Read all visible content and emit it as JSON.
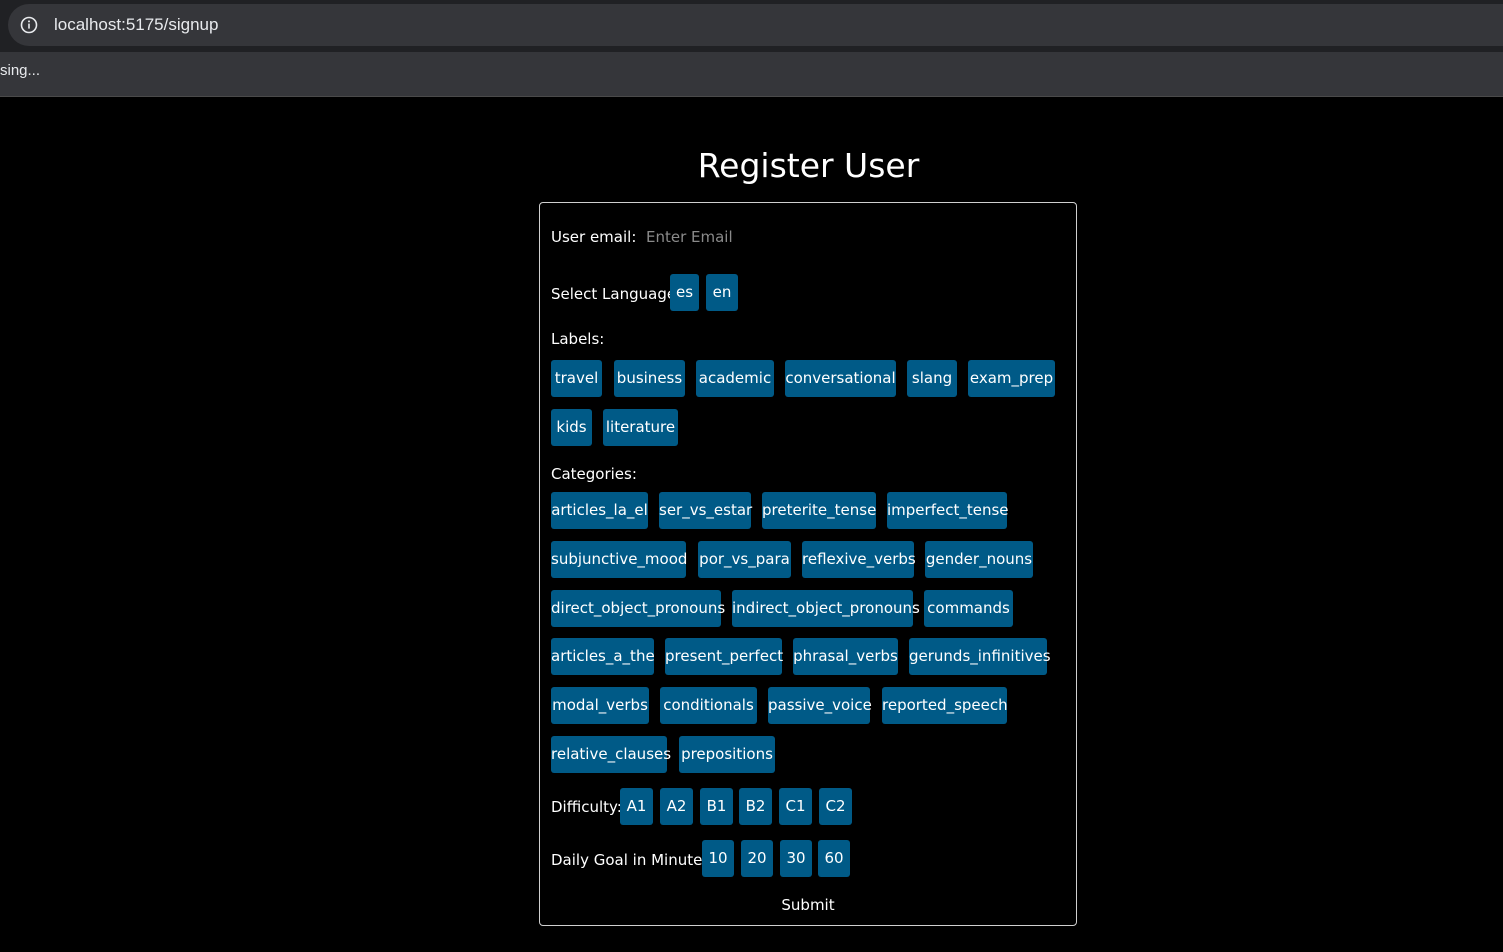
{
  "browser": {
    "url": "localhost:5175/signup",
    "bookmark": "sing..."
  },
  "page": {
    "title": "Register User"
  },
  "form": {
    "email_label": "User email:",
    "email_placeholder": "Enter Email",
    "language_label": "Select Language:",
    "languages": [
      "es",
      "en"
    ],
    "labels_label": "Labels:",
    "labels": [
      "travel",
      "business",
      "academic",
      "conversational",
      "slang",
      "exam_prep",
      "kids",
      "literature"
    ],
    "categories_label": "Categories:",
    "categories": [
      "articles_la_el",
      "ser_vs_estar",
      "preterite_tense",
      "imperfect_tense",
      "subjunctive_mood",
      "por_vs_para",
      "reflexive_verbs",
      "gender_nouns",
      "direct_object_pronouns",
      "indirect_object_pronouns",
      "commands",
      "articles_a_the",
      "present_perfect",
      "phrasal_verbs",
      "gerunds_infinitives",
      "modal_verbs",
      "conditionals",
      "passive_voice",
      "reported_speech",
      "relative_clauses",
      "prepositions"
    ],
    "difficulty_label": "Difficulty:",
    "difficulties": [
      "A1",
      "A2",
      "B1",
      "B2",
      "C1",
      "C2"
    ],
    "goal_label": "Daily Goal in Minutes:",
    "goals": [
      "10",
      "20",
      "30",
      "60"
    ],
    "submit_label": "Submit"
  },
  "colors": {
    "button_bg": "#005a87",
    "page_bg": "#000000",
    "form_border": "#d0d0d0"
  }
}
